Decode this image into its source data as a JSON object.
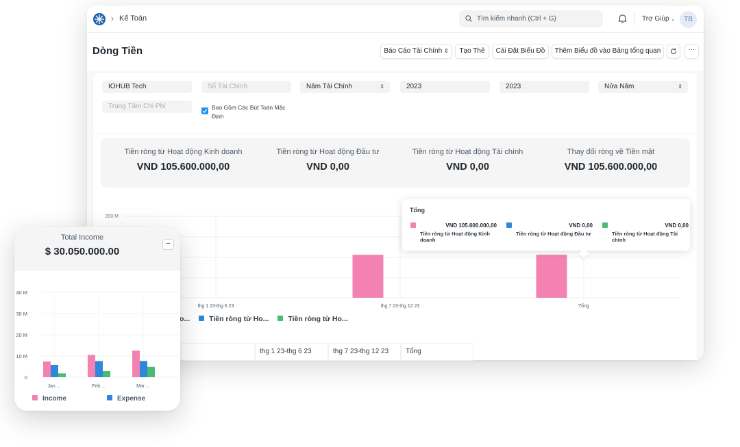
{
  "nav": {
    "breadcrumb": "Kế Toán",
    "search_placeholder": "Tìm kiếm nhanh (Ctrl + G)",
    "help_label": "Trợ Giúp",
    "avatar_initials": "TB"
  },
  "page": {
    "title": "Dòng Tiền",
    "buttons": {
      "report": "Báo Cáo Tài Chính",
      "create_card": "Tạo Thẻ",
      "chart_settings": "Cài Đặt Biểu Đồ",
      "add_to_dashboard": "Thêm Biểu đồ vào Bảng tổng quan"
    }
  },
  "filters": {
    "company": "IOHUB Tech",
    "finance_book_placeholder": "Sổ Tài Chính",
    "period_type": "Năm Tài Chính",
    "from_year": "2023",
    "to_year": "2023",
    "periodicity": "Nửa Năm",
    "cost_center_placeholder": "Trung Tâm Chi Phí",
    "include_default_entries": "Bao Gồm Các Bút Toán Mặc Định",
    "include_default_checked": true
  },
  "summary": [
    {
      "label": "Tiền ròng từ Hoạt động Kinh doanh",
      "value": "VND 105.600.000,00"
    },
    {
      "label": "Tiền ròng từ Hoạt động Đầu tư",
      "value": "VND 0,00"
    },
    {
      "label": "Tiền ròng từ Hoạt động Tài chính",
      "value": "VND 0,00"
    },
    {
      "label": "Thay đổi ròng về Tiền mặt",
      "value": "VND 105.600.000,00"
    }
  ],
  "colors": {
    "pink": "#f382b2",
    "blue": "#2f87d9",
    "green": "#48bb74",
    "accent": "#2490ef"
  },
  "chart_data": [
    {
      "type": "bar",
      "ytick_labels": [
        "200 M"
      ],
      "categories": [
        "thg 1 23-thg 6 23",
        "thg 7 23-thg 12 23",
        "Tổng"
      ],
      "series": [
        {
          "name": "Tiền ròng từ Hoạt động Kinh doanh",
          "legend_label": "",
          "values": [
            0,
            105600000,
            105600000
          ]
        },
        {
          "name": "Tiền ròng từ Hoạt động Đầu tư",
          "legend_label": "Tiền ròng từ Ho...",
          "values": [
            0,
            0,
            0
          ]
        },
        {
          "name": "Tiền ròng từ Hoạt động Tài chính",
          "legend_label": "Tiền ròng từ Ho...",
          "values": [
            0,
            0,
            0
          ]
        }
      ],
      "legend_partial": "o..."
    },
    {
      "type": "bar",
      "ytick_labels": [
        "40 M",
        "30 M",
        "20 M",
        "10 M",
        "0"
      ],
      "categories": [
        "Jan ...",
        "Feb ...",
        "Mar ..."
      ],
      "series": [
        {
          "name": "Income",
          "values": [
            7400000,
            10500000,
            12500000
          ]
        },
        {
          "name": "Expense",
          "values": [
            5800000,
            7600000,
            7600000
          ]
        },
        {
          "name": "",
          "values": [
            1800000,
            2900000,
            4900000
          ]
        }
      ]
    }
  ],
  "tooltip": {
    "title": "Tổng",
    "items": [
      {
        "value": "VND 105.600.000,00",
        "label": "Tiền ròng từ Hoạt động Kinh doanh"
      },
      {
        "value": "VND 0,00",
        "label": "Tiền ròng từ Hoạt động Đầu tư"
      },
      {
        "value": "VND 0,00",
        "label": "Tiền ròng từ Hoạt động Tài chính"
      }
    ]
  },
  "table": {
    "headers": [
      "thg 1 23-thg 6 23",
      "thg 7 23-thg 12 23",
      "Tổng"
    ]
  },
  "income_card": {
    "label": "Total Income",
    "value": "$ 30.050.000.00",
    "collapse_label": "−",
    "legend": [
      "Income",
      "Expense"
    ]
  }
}
